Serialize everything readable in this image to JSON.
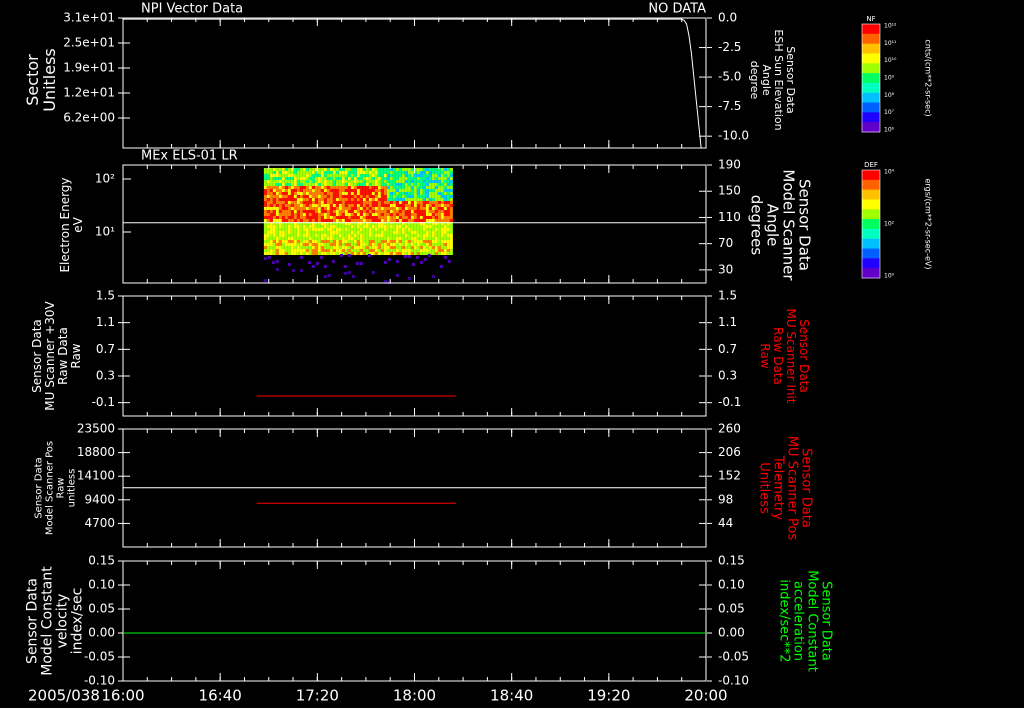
{
  "date_label": "2005/038",
  "time_ticks": [
    "16:00",
    "16:40",
    "17:20",
    "18:00",
    "18:40",
    "19:20",
    "20:00"
  ],
  "colors": {
    "white": "#ffffff",
    "red": "#ff0000",
    "green": "#00ff00",
    "bg": "#000000"
  },
  "colorbars": [
    {
      "tag": "NF",
      "label": "cnts/(cm**2-sr-sec)",
      "ticks": [
        "10¹²",
        "10¹¹",
        "10¹⁰",
        "10⁹",
        "10⁸",
        "10⁷",
        "10⁶"
      ]
    },
    {
      "tag": "DEF",
      "label": "ergs/(cm**2-sr-sec-eV)",
      "ticks": [
        "10⁴",
        "10²",
        "10⁰"
      ]
    }
  ],
  "chart_data": [
    {
      "type": "line",
      "title": "NPI Vector Data",
      "note": "NO DATA",
      "ylabel": [
        "Sector",
        "Unitless"
      ],
      "yticks": [
        "3.1e+01",
        "2.5e+01",
        "1.9e+01",
        "1.2e+01",
        "6.2e+00"
      ],
      "right_ylabel": [
        "Sensor Data",
        "ESH Sun Elevation",
        "Angle",
        "degree"
      ],
      "right_ylim": [
        -11,
        0
      ],
      "right_ticks": [
        "0.0",
        "-2.5",
        "-5.0",
        "-7.5",
        "-10.0"
      ],
      "series": [
        {
          "axis": "right",
          "color": "white",
          "x": [
            "16:00",
            "19:50",
            "19:51",
            "19:52",
            "19:53",
            "19:54",
            "19:55",
            "19:56",
            "19:57",
            "19:58"
          ],
          "y": [
            -0.1,
            -0.1,
            -0.2,
            -0.5,
            -1.5,
            -3.0,
            -5.0,
            -7.0,
            -9.0,
            -11.0
          ]
        }
      ]
    },
    {
      "type": "heatmap",
      "title": "MEx ELS-01 LR",
      "ylabel": [
        "Electron Energy",
        "eV"
      ],
      "yscale": "log",
      "ylim": [
        1,
        200
      ],
      "yticks": [
        "10²",
        "10¹"
      ],
      "right_ylabel": [
        "Sensor Data",
        "Model Scanner",
        "Angle",
        "degrees"
      ],
      "right_ylim": [
        10,
        190
      ],
      "right_ticks": [
        "190",
        "150",
        "110",
        "70",
        "30"
      ],
      "x_range": [
        "16:58",
        "18:15"
      ],
      "series": [
        {
          "name": "Model Scanner Angle",
          "axis": "right",
          "color": "white",
          "x": [
            "16:00",
            "20:00"
          ],
          "y": [
            102,
            102
          ]
        }
      ]
    },
    {
      "type": "line",
      "ylabel": [
        "Sensor Data",
        "MU Scanner +30V",
        "Raw Data",
        "Raw"
      ],
      "ylim": [
        -0.3,
        1.5
      ],
      "yticks": [
        "1.5",
        "1.1",
        "0.7",
        "0.3",
        "-0.1"
      ],
      "right_ylabel": [
        "Sensor Data",
        "MU Scanner Init",
        "Raw Data",
        "Raw"
      ],
      "right_ylim": [
        -0.3,
        1.5
      ],
      "right_ticks": [
        "1.5",
        "1.1",
        "0.7",
        "0.3",
        "-0.1"
      ],
      "series": [
        {
          "axis": "left",
          "color": "red",
          "x": [
            "16:55",
            "18:17"
          ],
          "y": [
            0.0,
            0.0
          ]
        }
      ]
    },
    {
      "type": "line",
      "ylabel": [
        "Sensor Data",
        "Model Scanner Pos",
        "Raw",
        "unitless"
      ],
      "ylim": [
        0,
        23500
      ],
      "yticks": [
        "23500",
        "18800",
        "14100",
        "9400",
        "4700"
      ],
      "right_ylabel": [
        "Sensor Data",
        "MU Scanner Pos",
        "Telemetry",
        "Unitless"
      ],
      "right_ylim": [
        -10,
        260
      ],
      "right_ticks": [
        "260",
        "206",
        "152",
        "98",
        "44"
      ],
      "series": [
        {
          "axis": "left",
          "color": "white",
          "x": [
            "16:00",
            "20:00"
          ],
          "y": [
            11800,
            11800
          ]
        },
        {
          "axis": "right",
          "color": "red",
          "x": [
            "16:55",
            "18:17"
          ],
          "y": [
            90,
            90
          ]
        }
      ]
    },
    {
      "type": "line",
      "ylabel": [
        "Sensor Data",
        "Model Constant",
        "velocity",
        "index/sec"
      ],
      "ylim": [
        -0.1,
        0.15
      ],
      "yticks": [
        "0.15",
        "0.10",
        "0.05",
        "0.00",
        "-0.05",
        "-0.10"
      ],
      "right_ylabel": [
        "Sensor Data",
        "Model Constant",
        "acceleration",
        "index/sec**2"
      ],
      "right_ylim": [
        -0.1,
        0.15
      ],
      "right_ticks": [
        "0.15",
        "0.10",
        "0.05",
        "0.00",
        "-0.05",
        "-0.10"
      ],
      "series": [
        {
          "axis": "left",
          "color": "green",
          "x": [
            "16:00",
            "20:00"
          ],
          "y": [
            0,
            0
          ]
        }
      ]
    }
  ]
}
